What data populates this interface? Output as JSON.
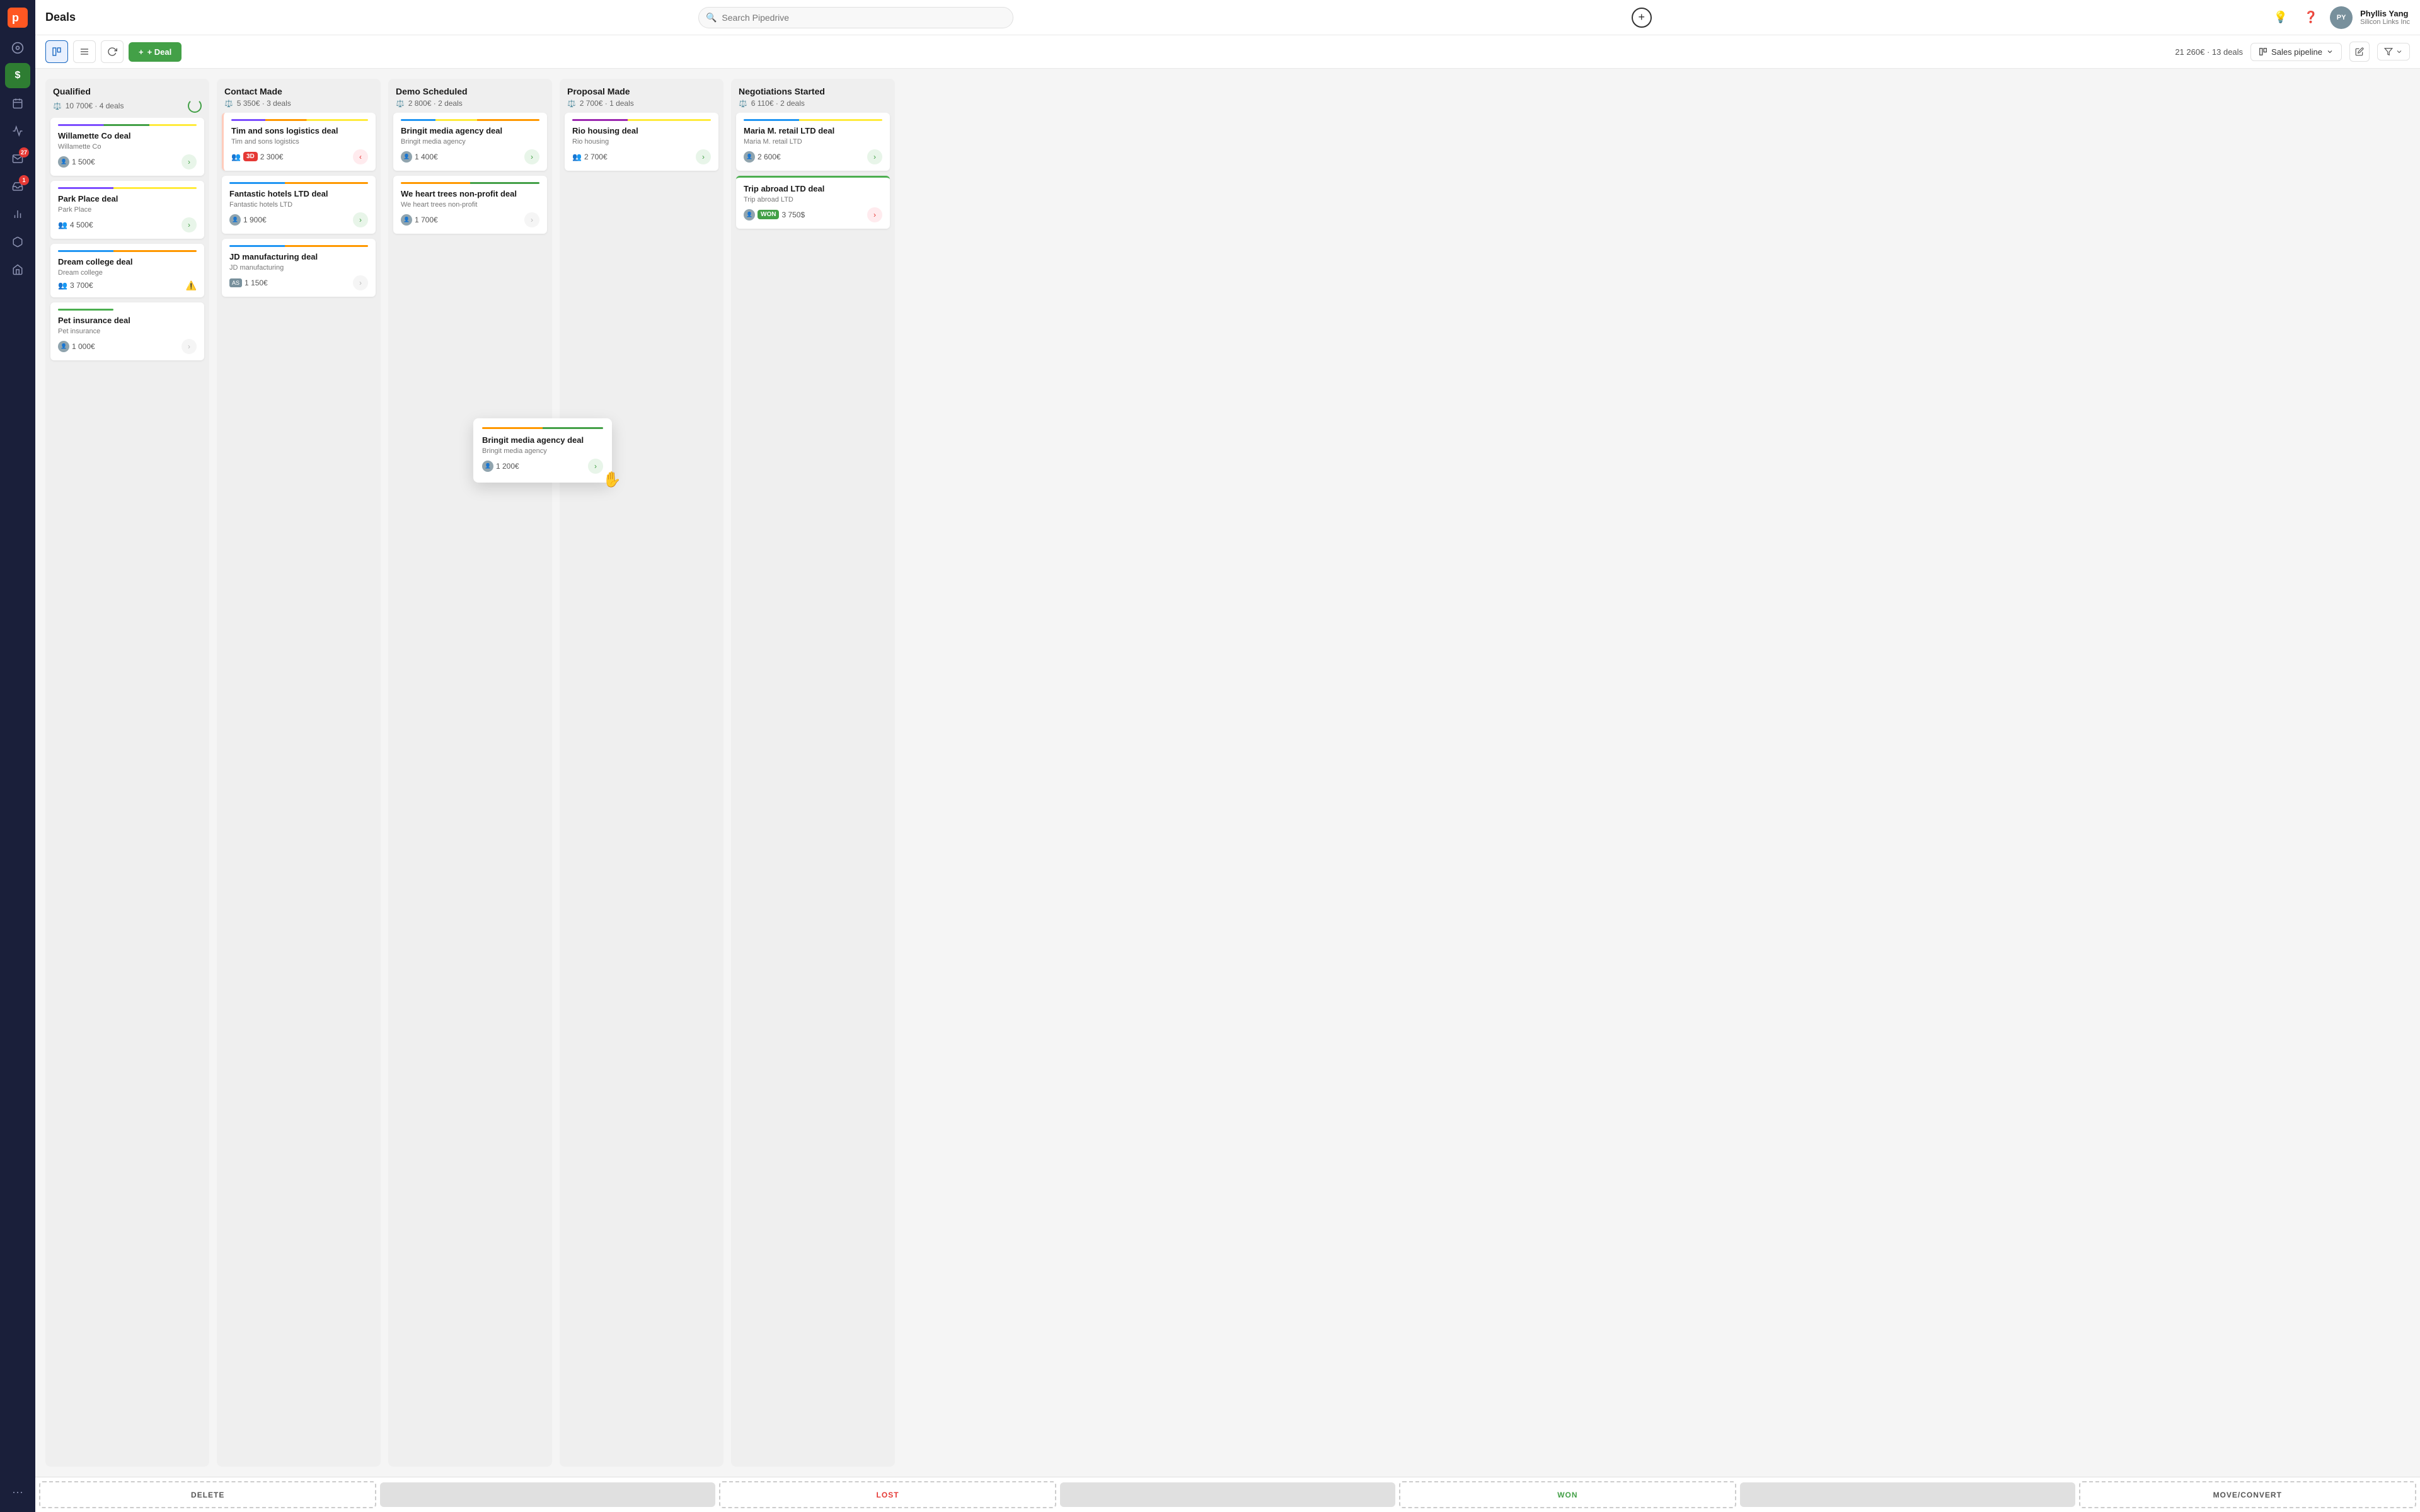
{
  "app": {
    "title": "Deals"
  },
  "header": {
    "search_placeholder": "Search Pipedrive",
    "add_tooltip": "+",
    "user": {
      "name": "Phyllis Yang",
      "company": "Silicon Links Inc",
      "avatar_initials": "PY"
    }
  },
  "toolbar": {
    "total": "21 260€",
    "deal_count": "13 deals",
    "deal_btn": "+ Deal",
    "pipeline_label": "Sales pipeline",
    "separator": "·"
  },
  "columns": [
    {
      "id": "qualified",
      "title": "Qualified",
      "amount": "10 700€",
      "deal_count": "4 deals",
      "accent_color": "#e0e0e0",
      "cards": [
        {
          "title": "Willamette Co deal",
          "company": "Willamette Co",
          "amount": "1 500€",
          "arrow": "green",
          "accent": "linear-gradient(to right, #7c4dff 33%, #43a047 33%, #43a047 66%, #ffeb3b 66%)",
          "avatar": true
        },
        {
          "title": "Park Place deal",
          "company": "Park Place",
          "amount": "4 500€",
          "arrow": "green",
          "accent": "linear-gradient(to right, #7c4dff 40%, #ffeb3b 40%)",
          "avatar": false,
          "person": true
        },
        {
          "title": "Dream college deal",
          "company": "Dream college",
          "amount": "3 700€",
          "arrow": "warn",
          "accent": "linear-gradient(to right, #2196f3 40%, #ff9800 40%)",
          "avatar": false,
          "person": true
        },
        {
          "title": "Pet insurance deal",
          "company": "Pet insurance",
          "amount": "1 000€",
          "arrow": "gray",
          "accent": "#4caf50",
          "avatar": true
        }
      ]
    },
    {
      "id": "contact_made",
      "title": "Contact Made",
      "amount": "5 350€",
      "deal_count": "3 deals",
      "accent_color": "#e0e0e0",
      "cards": [
        {
          "title": "Tim and sons logistics deal",
          "company": "Tim and sons logistics",
          "amount": "2 300€",
          "arrow": "red",
          "badge": "3D",
          "accent": "linear-gradient(to right, #7c4dff 30%, #ff9800 30%, #ff9800 60%, #ffeb3b 60%)",
          "avatar": false,
          "person": true
        },
        {
          "title": "Fantastic hotels LTD deal",
          "company": "Fantastic hotels LTD",
          "amount": "1 900€",
          "arrow": "green",
          "accent": "linear-gradient(to right, #2196f3 40%, #ff9800 40%)",
          "avatar": true
        },
        {
          "title": "JD manufacturing deal",
          "company": "JD manufacturing",
          "amount": "1 150€",
          "arrow": "gray",
          "accent": "linear-gradient(to right, #2196f3 40%, #ff9800 40%)",
          "avatar": false,
          "initials": "AS"
        }
      ]
    },
    {
      "id": "demo_scheduled",
      "title": "Demo Scheduled",
      "amount": "2 800€",
      "deal_count": "2 deals",
      "accent_color": "#e0e0e0",
      "cards": [
        {
          "title": "Bringit media agency deal",
          "company": "Bringit media agency",
          "amount": "1 400€",
          "arrow": "green",
          "accent": "linear-gradient(to right, #2196f3 30%, #ffeb3b 30%, #ffeb3b 60%, #ff9800 60%)",
          "avatar": true
        },
        {
          "title": "We heart trees non-profit deal",
          "company": "We heart trees non-profit",
          "amount": "1 700€",
          "arrow": "gray",
          "accent": "linear-gradient(to right, #ff9800 50%, #43a047 50%)",
          "avatar": true
        }
      ]
    },
    {
      "id": "proposal_made",
      "title": "Proposal Made",
      "amount": "2 700€",
      "deal_count": "1 deals",
      "accent_color": "#e0e0e0",
      "cards": [
        {
          "title": "Rio housing deal",
          "company": "Rio housing",
          "amount": "2 700€",
          "arrow": "green",
          "accent": "linear-gradient(to right, #9c27b0 40%, #ffeb3b 40%)",
          "avatar": false,
          "person": true
        }
      ]
    },
    {
      "id": "negotiations_started",
      "title": "Negotiations Started",
      "amount": "6 110€",
      "deal_count": "2 deals",
      "accent_color": "#e0e0e0",
      "cards": [
        {
          "title": "Maria M. retail LTD deal",
          "company": "Maria M. retail LTD",
          "amount": "2 600€",
          "arrow": "green",
          "accent": "linear-gradient(to right, #2196f3 40%, #ffeb3b 40%)",
          "avatar": true
        },
        {
          "title": "Trip abroad LTD deal",
          "company": "Trip abroad LTD",
          "amount": "3 750$",
          "arrow": "red",
          "badge_won": "WON",
          "accent": "#4caf50",
          "avatar": true
        }
      ]
    }
  ],
  "floating_card": {
    "title": "Bringit media agency deal",
    "company": "Bringit media agency",
    "amount": "1 200€"
  },
  "drop_zones": [
    {
      "label": "DELETE",
      "type": "delete"
    },
    {
      "label": "LOST",
      "type": "lost"
    },
    {
      "label": "WON",
      "type": "won"
    },
    {
      "label": "MOVE/CONVERT",
      "type": "move"
    }
  ],
  "sidebar": {
    "items": [
      {
        "icon": "🏠",
        "label": "home",
        "active": false
      },
      {
        "icon": "$",
        "label": "deals",
        "active": true
      },
      {
        "icon": "☎",
        "label": "activities",
        "active": false
      },
      {
        "icon": "📢",
        "label": "campaigns",
        "active": false
      },
      {
        "icon": "✉",
        "label": "mail",
        "active": false,
        "badge": 27
      },
      {
        "icon": "📥",
        "label": "inbox",
        "active": false,
        "badge": 1
      },
      {
        "icon": "📊",
        "label": "reports",
        "active": false
      },
      {
        "icon": "📦",
        "label": "products",
        "active": false
      },
      {
        "icon": "🏪",
        "label": "marketplace",
        "active": false
      }
    ]
  }
}
